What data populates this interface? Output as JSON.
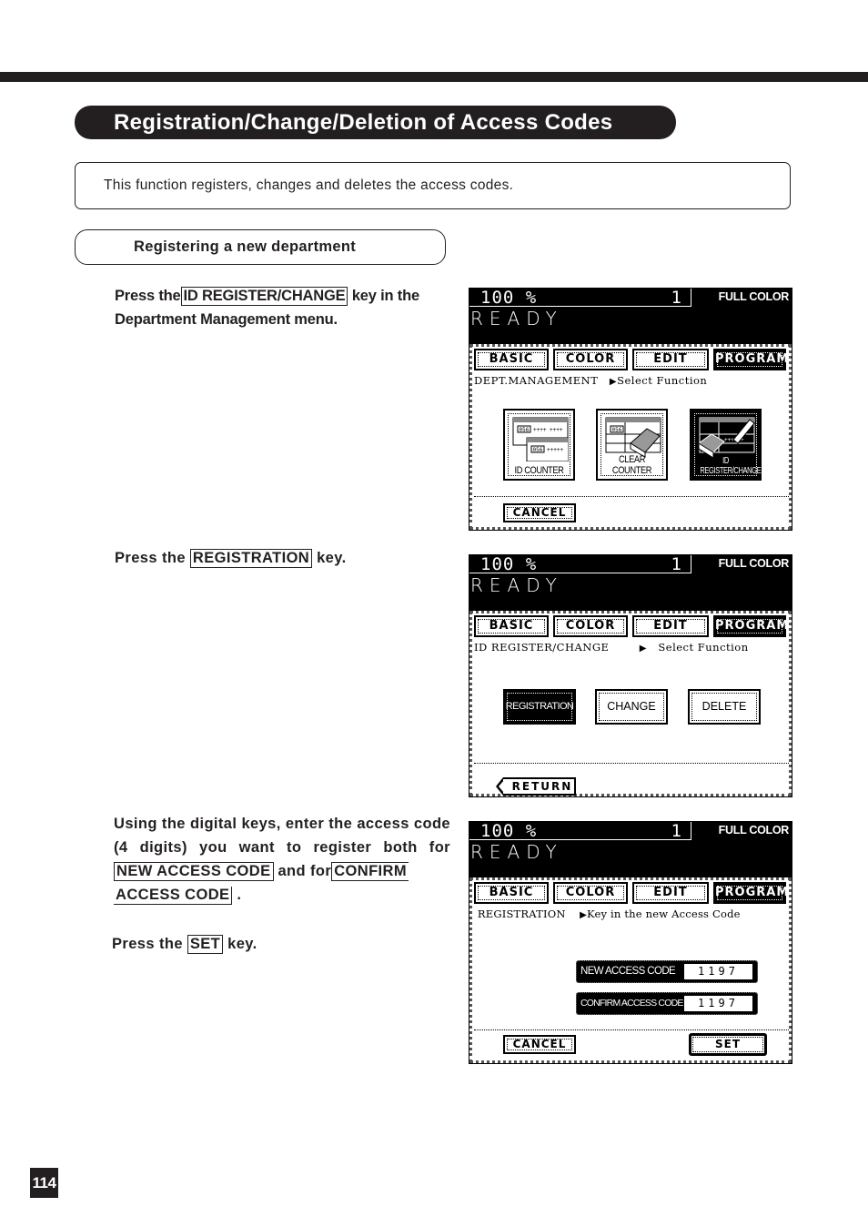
{
  "page": {
    "title": "Registration/Change/Deletion of Access Codes",
    "intro": "This function registers, changes and deletes the access codes.",
    "section_title": "Registering a new department",
    "page_number": "114"
  },
  "steps": [
    {
      "before": "Press the",
      "key": "ID REGISTER/CHANGE",
      "after": "key in the Department Management menu."
    },
    {
      "before": "Press the",
      "key": "REGISTRATION",
      "after": "key."
    },
    {
      "text1": "Using the digital keys, enter the access code (4 digits) you want to register both for",
      "key1": "NEW ACCESS CODE",
      "text2": "and for",
      "key2a": "CONFIRM",
      "key2b": "ACCESS CODE",
      "text3": "."
    },
    {
      "before": "Press the",
      "key": "SET",
      "after": "key."
    }
  ],
  "lcd_common": {
    "ratio": "100  %",
    "copies": "1",
    "color_mode": "FULL COLOR",
    "status": "READY",
    "tabs": [
      "BASIC",
      "COLOR",
      "EDIT",
      "PROGRAM"
    ],
    "active_tab": "PROGRAM"
  },
  "screens": [
    {
      "crumb_left": "DEPT.MANAGEMENT",
      "crumb_right": "Select Function",
      "icons": [
        {
          "label": "ID COUNTER",
          "icon": "counter-table-icon",
          "active": false
        },
        {
          "label": "CLEAR COUNTER",
          "icon": "eraser-table-icon",
          "active": false
        },
        {
          "label": "ID REGISTER/CHANGE",
          "icon": "pencil-eraser-table-icon",
          "active": true
        }
      ],
      "icon_sample_id": "056",
      "cancel_label": "CANCEL"
    },
    {
      "crumb_left": "ID REGISTER/CHANGE",
      "crumb_right": "Select Function",
      "buttons": [
        {
          "label": "REGISTRATION",
          "active": true
        },
        {
          "label": "CHANGE",
          "active": false
        },
        {
          "label": "DELETE",
          "active": false
        }
      ],
      "return_label": "RETURN"
    },
    {
      "crumb_left": "REGISTRATION",
      "crumb_right": "Key in the new Access Code",
      "fields": [
        {
          "label": "NEW ACCESS CODE",
          "value": "1197"
        },
        {
          "label": "CONFIRM ACCESS CODE",
          "value": "1197"
        }
      ],
      "cancel_label": "CANCEL",
      "set_label": "SET"
    }
  ]
}
